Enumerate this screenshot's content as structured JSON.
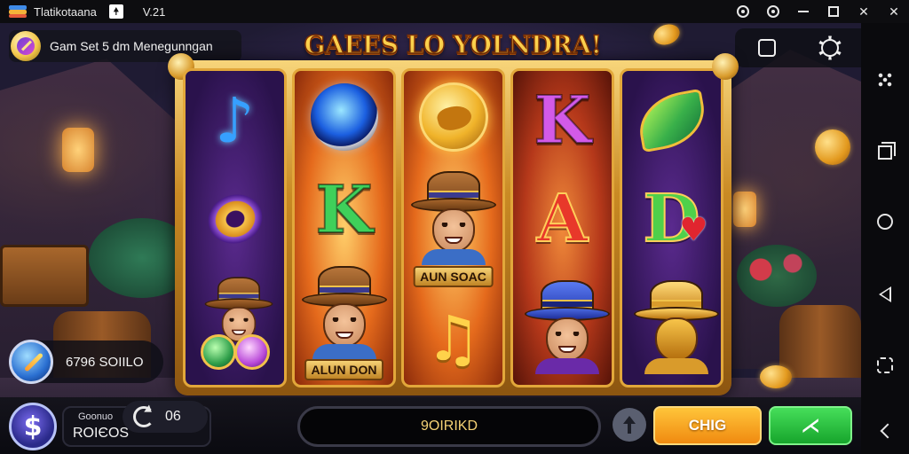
{
  "window": {
    "title": "Tlatikotaana",
    "version": "V.21"
  },
  "game": {
    "title": "GAEES LO YOLNDRA!",
    "mode_label": "Gam Set 5 dm Menegunngan",
    "balance_text": "6796 SOIILO",
    "reels": [
      {
        "theme": "purple",
        "symbols": [
          "note-blue",
          "coin-ring",
          "character-orbs"
        ]
      },
      {
        "theme": "orange",
        "symbols": [
          "gem-blue",
          "letter-K-green",
          "character-hat"
        ]
      },
      {
        "theme": "orange",
        "symbols": [
          "coin-gold",
          "character-center",
          "note-gold"
        ]
      },
      {
        "theme": "red",
        "symbols": [
          "letter-K-purple",
          "letter-A-red",
          "character-blue-hat"
        ]
      },
      {
        "theme": "purple",
        "symbols": [
          "leaf-gem",
          "letter-D-green",
          "character-gold"
        ]
      }
    ],
    "symbol_text": {
      "k1": "K",
      "k2": "K",
      "a": "A",
      "d": "D",
      "note1": "♪",
      "note2": "♫",
      "heart": "♥"
    },
    "name_plate_center": "AUN SOAC",
    "name_plate_left": "ALUN DON"
  },
  "bottom_bar": {
    "stat_label": "Goonuo",
    "stat_value": "RОІЄОS",
    "bet_value": "06",
    "message": "9OIRIKD",
    "spin_label": "CHIG",
    "auto_label": "⋌",
    "wallet_glyph": "$"
  },
  "colors": {
    "title_gold": "#ffd24d",
    "spin_orange": "#f08a10",
    "auto_green": "#17a52c",
    "message_text": "#f5d275"
  },
  "icons": {
    "titlebar": [
      "app-logo",
      "pin-icon",
      "record-icon",
      "settings-ring-icon",
      "minimize-icon",
      "maximize-icon",
      "close-icon"
    ],
    "top_right": [
      "square-icon",
      "gear-icon"
    ],
    "nav": [
      "more-dots-icon",
      "recents-icon",
      "home-icon",
      "back-icon",
      "screenshot-icon",
      "collapse-icon"
    ]
  }
}
